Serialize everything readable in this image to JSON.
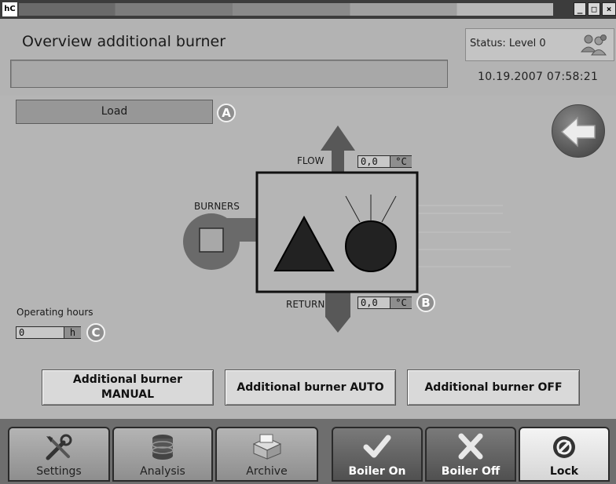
{
  "window": {
    "logo": "hC",
    "buttons": {
      "minimize": "_",
      "maximize": "□",
      "close": "×"
    }
  },
  "header": {
    "title": "Overview additional burner",
    "status": "Status: Level 0",
    "datetime": "10.19.2007 07:58:21",
    "message": "",
    "users_icon": "users-icon"
  },
  "main": {
    "load_label": "Load",
    "callouts": {
      "a": "A",
      "b": "B",
      "c": "C"
    },
    "back_icon": "arrow-left-icon",
    "diagram": {
      "flow_label": "FLOW",
      "flow_value": "0,0",
      "flow_unit": "°C",
      "return_label": "RETURN",
      "return_value": "0,0",
      "return_unit": "°C",
      "burners_label": "BURNERS"
    },
    "operating_hours_label": "Operating hours",
    "operating_hours_value": "0",
    "operating_hours_unit": "h"
  },
  "modes": {
    "manual_line1": "Additional burner",
    "manual_line2": "MANUAL",
    "auto": "Additional burner AUTO",
    "off": "Additional burner OFF"
  },
  "nav": {
    "settings": "Settings",
    "analysis": "Analysis",
    "archive": "Archive",
    "boiler_on": "Boiler On",
    "boiler_off": "Boiler Off",
    "lock": "Lock"
  },
  "colors": {
    "panel": "#b5b5b5",
    "header": "#b3b3b3",
    "dark": "#3c3c3c",
    "navbar": "#6e6e6e"
  }
}
